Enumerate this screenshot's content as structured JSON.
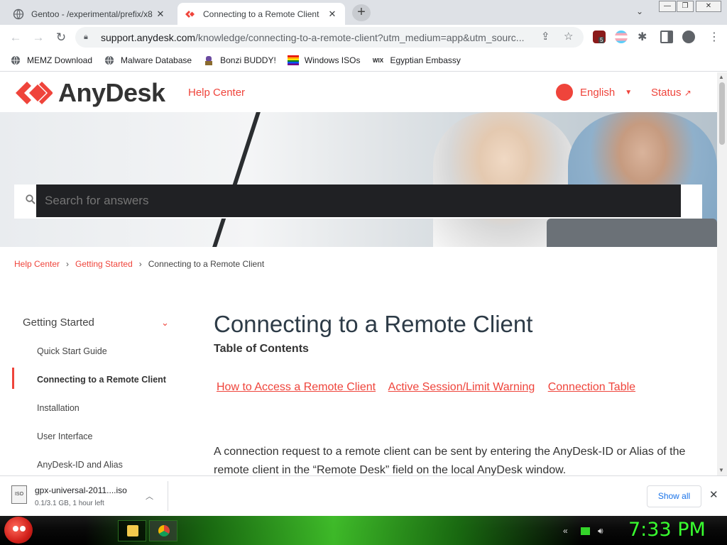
{
  "browser": {
    "tabs": [
      {
        "title": "Gentoo - /experimental/prefix/x8",
        "active": false
      },
      {
        "title": "Connecting to a Remote Client",
        "active": true
      }
    ],
    "new_tab_label": "+",
    "tab_search_label": "⌄",
    "window_controls": {
      "minimize": "—",
      "maximize": "❐",
      "close": "✕"
    },
    "nav": {
      "back": "←",
      "forward": "→",
      "reload": "↻"
    },
    "omnibox": {
      "url_host": "support.anydesk.com",
      "url_rest": "/knowledge/connecting-to-a-remote-client?utm_medium=app&utm_sourc..."
    },
    "extension_badge": "5",
    "bookmarks": [
      {
        "label": "MEMZ Download",
        "icon": "globe-icon"
      },
      {
        "label": "Malware Database",
        "icon": "globe-icon"
      },
      {
        "label": "Bonzi BUDDY!",
        "icon": "bonzi-icon"
      },
      {
        "label": "Windows ISOs",
        "icon": "windows-flag-icon"
      },
      {
        "label": "Egyptian Embassy",
        "icon": "wix-icon"
      }
    ]
  },
  "site": {
    "logo_text": "AnyDesk",
    "help_center": "Help Center",
    "language": "English",
    "status": "Status",
    "search_placeholder": "Search for answers",
    "breadcrumbs": [
      "Help Center",
      "Getting Started",
      "Connecting to a Remote Client"
    ],
    "sidebar": {
      "heading": "Getting Started",
      "items": [
        {
          "label": "Quick Start Guide",
          "active": false
        },
        {
          "label": "Connecting to a Remote Client",
          "active": true
        },
        {
          "label": "Installation",
          "active": false
        },
        {
          "label": "User Interface",
          "active": false
        },
        {
          "label": "AnyDesk-ID and Alias",
          "active": false
        }
      ]
    },
    "article": {
      "title": "Connecting to a Remote Client",
      "toc_title": "Table of Contents",
      "toc_links": [
        "How to Access a Remote Client",
        "Active Session/Limit Warning",
        "Connection Table"
      ],
      "paragraph": "A connection request to a remote client can be sent by entering the AnyDesk-ID or Alias of the remote client in the “Remote Desk” field on the local AnyDesk window."
    },
    "accent_color": "#ef443b"
  },
  "download_shelf": {
    "file_name": "gpx-universal-2011....iso",
    "file_badge": "ISO",
    "status": "0.1/3.1 GB, 1 hour left",
    "show_all": "Show all",
    "close": "✕"
  },
  "taskbar": {
    "clock": "7:33 PM",
    "clock_color": "#39ff2f"
  }
}
